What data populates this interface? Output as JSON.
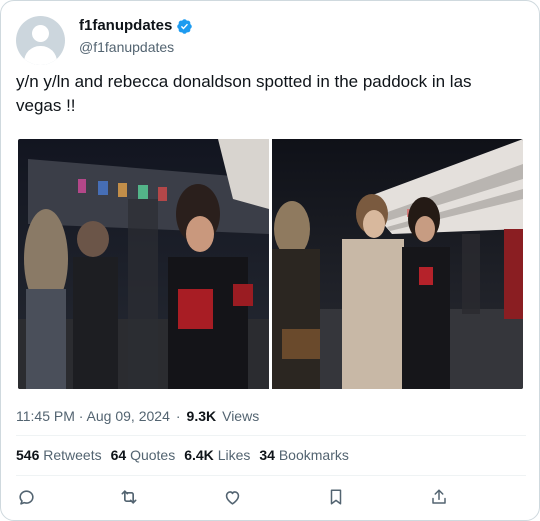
{
  "user": {
    "display_name": "f1fanupdates",
    "handle": "@f1fanupdates",
    "verified": true,
    "verified_color": "#1d9bf0"
  },
  "tweet": {
    "text": "y/n y/ln and rebecca donaldson spotted in the paddock in las vegas !!"
  },
  "media": {
    "count": 2,
    "items": [
      "photo",
      "photo"
    ]
  },
  "meta": {
    "time": "11:45 PM",
    "date": "Aug 09, 2024",
    "time_date": "11:45 PM · Aug 09, 2024",
    "separator": "·",
    "views_count": "9.3K",
    "views_label": "Views"
  },
  "stats": {
    "retweets_count": "546",
    "retweets_label": "Retweets",
    "quotes_count": "64",
    "quotes_label": "Quotes",
    "likes_count": "6.4K",
    "likes_label": "Likes",
    "bookmarks_count": "34",
    "bookmarks_label": "Bookmarks"
  },
  "actions": {
    "icons": [
      "reply-icon",
      "retweet-icon",
      "like-icon",
      "bookmark-icon",
      "share-icon"
    ],
    "color": "#536471"
  }
}
